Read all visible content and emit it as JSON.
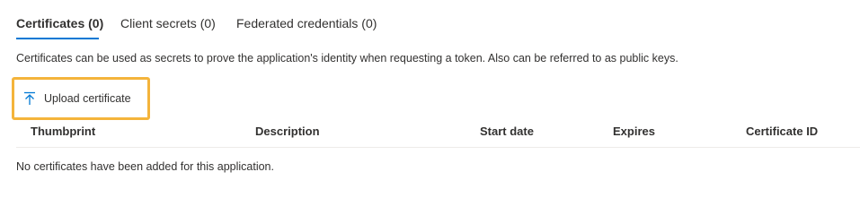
{
  "tabs": [
    {
      "label": "Certificates (0)",
      "active": true
    },
    {
      "label": "Client secrets (0)",
      "active": false
    },
    {
      "label": "Federated credentials (0)",
      "active": false
    }
  ],
  "description": "Certificates can be used as secrets to prove the application's identity when requesting a token. Also can be referred to as public keys.",
  "toolbar": {
    "upload_label": "Upload certificate",
    "upload_icon": "upload-icon",
    "highlight_color": "#f4b43b",
    "icon_color": "#0078d4"
  },
  "table": {
    "columns": [
      "Thumbprint",
      "Description",
      "Start date",
      "Expires",
      "Certificate ID"
    ],
    "empty_message": "No certificates have been added for this application."
  },
  "colors": {
    "accent": "#0078d4",
    "text": "#323130",
    "divider": "#edebe9"
  }
}
